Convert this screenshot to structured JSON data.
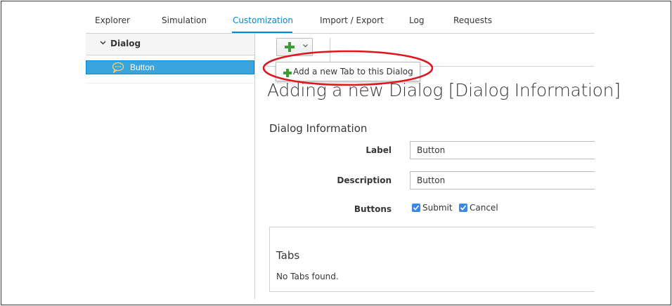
{
  "nav": {
    "tabs": [
      {
        "label": "Explorer"
      },
      {
        "label": "Simulation"
      },
      {
        "label": "Customization",
        "active": true
      },
      {
        "label": "Import / Export"
      },
      {
        "label": "Log"
      },
      {
        "label": "Requests"
      }
    ],
    "accent_color": "#0088ce"
  },
  "sidebar": {
    "header_label": "Dialog",
    "items": [
      {
        "label": "Button",
        "selected": true,
        "icon": "comment-bubble-icon"
      }
    ],
    "selected_color": "#39a5dc"
  },
  "toolbar": {
    "add_button_icon": "plus-icon",
    "dropdown_icon": "chevron-down-icon"
  },
  "dropdown_menu": {
    "items": [
      {
        "label": "Add a new Tab to this Dialog",
        "icon": "plus-icon"
      }
    ],
    "annotation_color": "#e0141c"
  },
  "main": {
    "page_title": "Adding a new Dialog [Dialog Information]",
    "section_title": "Dialog Information",
    "fields": {
      "label": {
        "label": "Label",
        "value": "Button"
      },
      "description": {
        "label": "Description",
        "value": "Button"
      }
    },
    "buttons": {
      "label": "Buttons",
      "options": [
        {
          "label": "Submit",
          "checked": true
        },
        {
          "label": "Cancel",
          "checked": true
        }
      ],
      "checkbox_color": "#3a87e6"
    },
    "tabs_section": {
      "title": "Tabs",
      "empty_text": "No Tabs found."
    }
  }
}
